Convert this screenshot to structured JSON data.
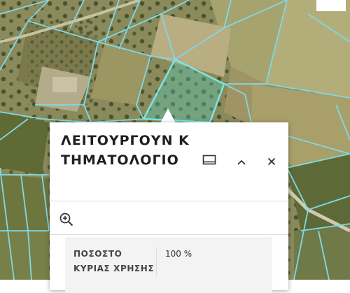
{
  "map": {
    "basemap": "satellite imagery",
    "parcel_line_color": "#7fd9e6",
    "selected_parcel_fill": "#4ed1c2"
  },
  "popup": {
    "title": "ΛΕΙΤΟΥΡΓΟΥΝ ΚΤΗΜΑΤΟΛΟΓΙΟ",
    "buttons": {
      "dock": "dock-icon",
      "collapse": "chevron-up-icon",
      "close": "close-icon",
      "zoom_to": "zoom-in-icon"
    },
    "attributes": [
      {
        "key": "ΠΟΣΟΣΤΟ ΚΥΡΙΑΣ ΧΡΗΣΗΣ",
        "value": "100 %"
      }
    ]
  }
}
